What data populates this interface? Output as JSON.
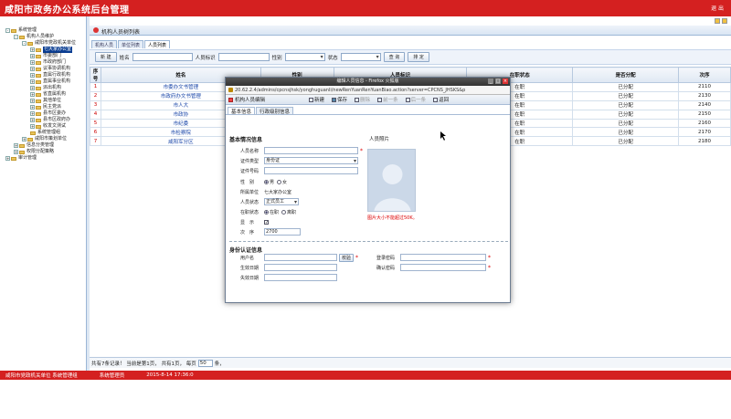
{
  "app": {
    "title": "咸阳市政务办公系统后台管理",
    "exit_label": "退 出"
  },
  "sidebar": {
    "items": [
      {
        "label": "系统管理",
        "level": 0,
        "toggle": "-"
      },
      {
        "label": "机构人员维护",
        "level": 1,
        "toggle": "-"
      },
      {
        "label": "咸阳市党政机关单位",
        "level": 2,
        "toggle": "-"
      },
      {
        "label": "七大家办公室",
        "level": 3,
        "toggle": "+",
        "selected": true
      },
      {
        "label": "市委部门",
        "level": 3,
        "toggle": "+"
      },
      {
        "label": "市政府部门",
        "level": 3,
        "toggle": "+"
      },
      {
        "label": "议事协调机构",
        "level": 3,
        "toggle": "+"
      },
      {
        "label": "直属行政机构",
        "level": 3,
        "toggle": "+"
      },
      {
        "label": "直属事业机构",
        "level": 3,
        "toggle": "+"
      },
      {
        "label": "派出机构",
        "level": 3,
        "toggle": "+"
      },
      {
        "label": "省直属机构",
        "level": 3,
        "toggle": "+"
      },
      {
        "label": "其他单位",
        "level": 3,
        "toggle": "+"
      },
      {
        "label": "民主党派",
        "level": 3,
        "toggle": "+"
      },
      {
        "label": "县市区委办",
        "level": 3,
        "toggle": "+"
      },
      {
        "label": "县市区政府办",
        "level": 3,
        "toggle": "+"
      },
      {
        "label": "收发文测试",
        "level": 3,
        "toggle": "+"
      },
      {
        "label": "系统管理组",
        "level": 3,
        "toggle": ""
      },
      {
        "label": "咸阳市策划单位",
        "level": 2,
        "toggle": "+"
      },
      {
        "label": "信息分类管理",
        "level": 1,
        "toggle": "+"
      },
      {
        "label": "权限分配策略",
        "level": 1,
        "toggle": "+"
      },
      {
        "label": "审计管理",
        "level": 0,
        "toggle": "+"
      }
    ]
  },
  "main": {
    "panel_title": "机构人员树列表",
    "tabs": [
      "机构人员",
      "单位列表",
      "人员列表"
    ],
    "filter": {
      "new_label": "新 建",
      "name_label": "姓名",
      "id_label": "人员标识",
      "gender_label": "性别",
      "status_label": "状态",
      "search_label": "查 询",
      "sort_label": "排 定"
    },
    "columns": [
      "序号",
      "姓名",
      "性别",
      "人员标识",
      "在职状态",
      "是否分配",
      "次序"
    ],
    "rows": [
      {
        "no": "1",
        "name": "市委办文书管理",
        "gender": "",
        "id": "",
        "status": "在职",
        "assigned": "已分配",
        "order": "2110"
      },
      {
        "no": "2",
        "name": "市政府办文书管理",
        "gender": "",
        "id": "",
        "status": "在职",
        "assigned": "已分配",
        "order": "2130"
      },
      {
        "no": "3",
        "name": "市人大",
        "gender": "",
        "id": "",
        "status": "在职",
        "assigned": "已分配",
        "order": "2140"
      },
      {
        "no": "4",
        "name": "市政协",
        "gender": "",
        "id": "",
        "status": "在职",
        "assigned": "已分配",
        "order": "2150"
      },
      {
        "no": "5",
        "name": "市纪委",
        "gender": "",
        "id": "",
        "status": "在职",
        "assigned": "已分配",
        "order": "2160"
      },
      {
        "no": "6",
        "name": "市检察院",
        "gender": "",
        "id": "",
        "status": "在职",
        "assigned": "已分配",
        "order": "2170"
      },
      {
        "no": "7",
        "name": "咸阳军分区",
        "gender": "",
        "id": "",
        "status": "在职",
        "assigned": "已分配",
        "order": "2180"
      }
    ],
    "pager": {
      "text_before": "共有7条记录！ 当前是第1页， 共有1页， 每页",
      "page_size": "50",
      "text_after": "条，"
    }
  },
  "modal": {
    "window_title": "编辑人员信息 - Firefox 火狐版",
    "url": "20.62.2.4/admins/cpcnsjhsk/yonghuguanli/newRenYuanRenYuanBiao.action?server=CPCNS_JHSKS&p",
    "toolbar_title": "机构人员编辑",
    "toolbar": [
      "新建",
      "保存",
      "删除",
      "前一条",
      "后一条",
      "返回"
    ],
    "tabs": [
      "基本信息",
      "行政级别信息"
    ],
    "basic_section": "基本情况信息",
    "photo_label": "人员照片",
    "photo_note": "图片大小不能超过50K。",
    "fields": {
      "name_label": "人员名称",
      "doc_type_label": "证件类型",
      "doc_type_value": "身份证",
      "doc_no_label": "证件号码",
      "gender_label": "性　别",
      "gender_opts": [
        "男",
        "女"
      ],
      "unit_label": "所属单位",
      "unit_value": "七大家办公室",
      "status_label": "人员状态",
      "status_value": "正式员工",
      "onjob_label": "在职状态",
      "onjob_opts": [
        "在职",
        "离职"
      ],
      "show_label": "显　示",
      "order_label": "次　序",
      "order_value": "2700"
    },
    "auth_section": "身份认证信息",
    "auth": {
      "user_label": "用户名",
      "check_label": "校验",
      "start_label": "生效日期",
      "end_label": "失效日期",
      "pwd_label": "登录密码",
      "pwd2_label": "确认密码"
    }
  },
  "footer": {
    "unit": "咸阳市党政机关单位 系统管理组",
    "user": "系统管理员",
    "time": "2015-8-14 17:36:0"
  }
}
